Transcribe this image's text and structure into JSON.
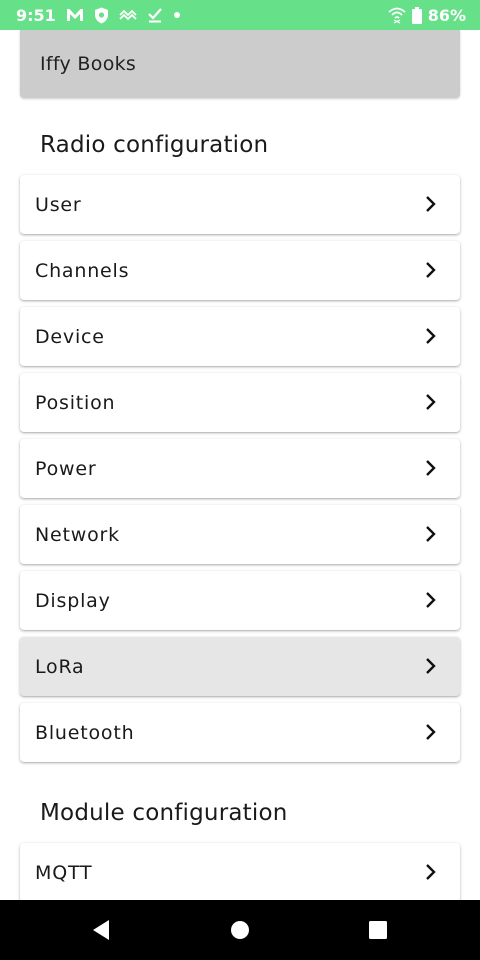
{
  "status_bar": {
    "time": "9:51",
    "left_icons": [
      "gmail-icon",
      "shield-icon",
      "signal-wave-icon",
      "check-download-icon",
      "dot-icon"
    ],
    "right_icons": [
      "wifi-icon",
      "battery-icon"
    ],
    "battery": "86%"
  },
  "header": {
    "device_name": "Iffy Books"
  },
  "radio_section": {
    "title": "Radio configuration",
    "items": [
      {
        "label": "User"
      },
      {
        "label": "Channels"
      },
      {
        "label": "Device"
      },
      {
        "label": "Position"
      },
      {
        "label": "Power"
      },
      {
        "label": "Network"
      },
      {
        "label": "Display"
      },
      {
        "label": "LoRa"
      },
      {
        "label": "Bluetooth"
      }
    ]
  },
  "module_section": {
    "title": "Module configuration",
    "items": [
      {
        "label": "MQTT"
      }
    ]
  },
  "nav_bar": {
    "buttons": [
      "back-icon",
      "home-icon",
      "recents-icon"
    ]
  },
  "colors": {
    "status_bar_bg": "#67e08a",
    "header_card_bg": "#cccccc",
    "pressed_item_bg": "#e6e6e6"
  }
}
